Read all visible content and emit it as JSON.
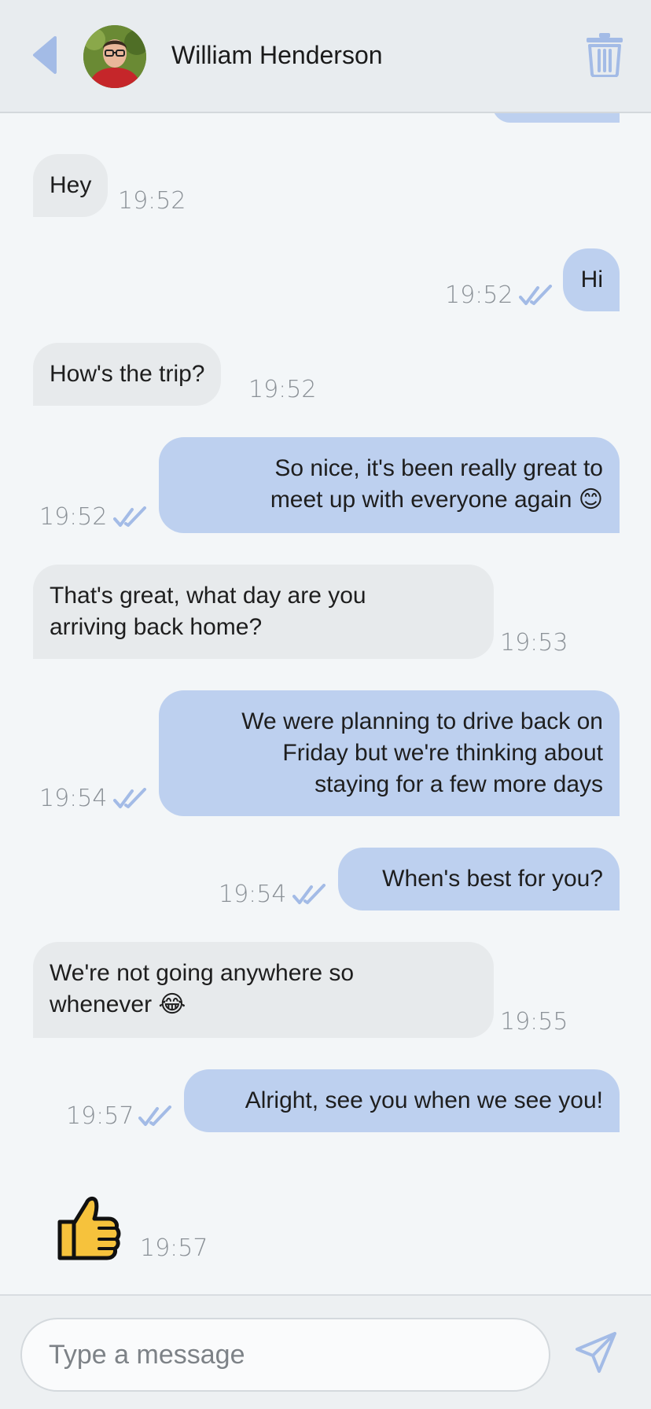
{
  "header": {
    "contact_name": "William Henderson"
  },
  "icons": {
    "back": "back-arrow-icon",
    "delete": "trash-icon",
    "send": "send-icon",
    "read_receipt": "double-check-icon"
  },
  "colors": {
    "accent": "#a3bbe6",
    "incoming_bubble": "#e7eaec",
    "outgoing_bubble": "#bdd0ef",
    "background": "#f3f6f8"
  },
  "messages": [
    {
      "direction": "out",
      "text": "",
      "time": "19:52",
      "read": true,
      "partial": true
    },
    {
      "direction": "in",
      "text": "Hey",
      "time": "19:52"
    },
    {
      "direction": "out",
      "text": "Hi",
      "time": "19:52",
      "read": true
    },
    {
      "direction": "in",
      "text": "How's the trip?",
      "time": "19:52"
    },
    {
      "direction": "out",
      "text_lines": [
        "So nice, it's been really great to",
        "meet up with everyone again 😊"
      ],
      "time": "19:52",
      "read": true
    },
    {
      "direction": "in",
      "text_lines": [
        "That's great, what day are you",
        "arriving back home?"
      ],
      "time": "19:53"
    },
    {
      "direction": "out",
      "text_lines": [
        "We were planning to drive back on",
        "Friday but we're thinking about",
        "staying for a few more days"
      ],
      "time": "19:54",
      "read": true
    },
    {
      "direction": "out",
      "text": "When's best for you?",
      "time": "19:54",
      "read": true
    },
    {
      "direction": "in",
      "text_lines": [
        "We're not going anywhere so",
        "whenever 😂"
      ],
      "time": "19:55"
    },
    {
      "direction": "out",
      "text": "Alright, see you when we see you!",
      "time": "19:57",
      "read": true
    },
    {
      "direction": "in",
      "emoji": "👍",
      "emoji_name": "thumbs-up-emoji",
      "time": "19:57"
    }
  ],
  "composer": {
    "placeholder": "Type a message"
  }
}
